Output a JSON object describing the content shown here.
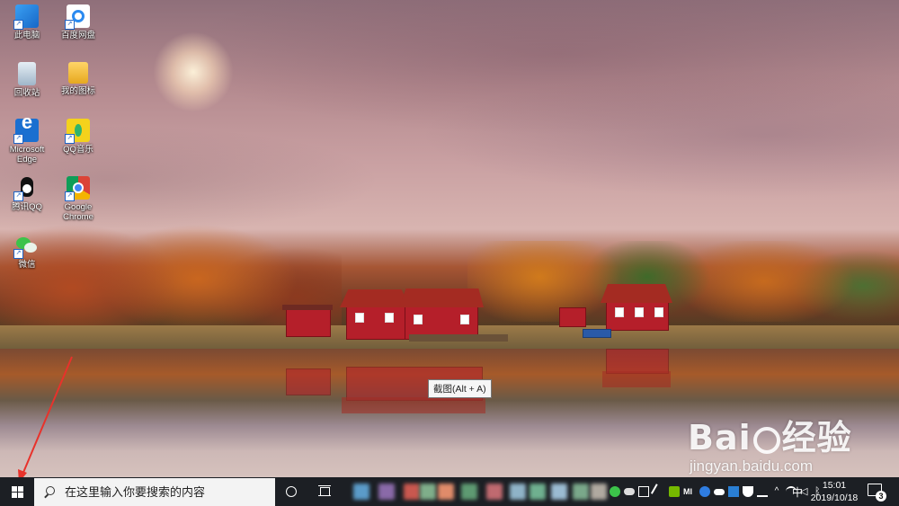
{
  "desktop": {
    "icons": [
      {
        "label": "此电脑",
        "icon": "this-pc-icon"
      },
      {
        "label": "百度网盘",
        "icon": "baidu-netdisk-icon"
      },
      {
        "label": "回收站",
        "icon": "recycle-bin-icon"
      },
      {
        "label": "我的图标",
        "icon": "folder-icon"
      },
      {
        "label": "Microsoft Edge",
        "icon": "edge-icon"
      },
      {
        "label": "QQ音乐",
        "icon": "qq-music-icon"
      },
      {
        "label": "腾讯QQ",
        "icon": "qq-penguin-icon"
      },
      {
        "label": "Google Chrome",
        "icon": "chrome-icon"
      },
      {
        "label": "微信",
        "icon": "wechat-icon"
      }
    ]
  },
  "tooltip": {
    "text": "截图(Alt + A)"
  },
  "watermark": {
    "logo_left": "Bai",
    "logo_right": "经验",
    "url": "jingyan.baidu.com"
  },
  "annotation": {
    "color": "#e8322b",
    "points_to": "start-button"
  },
  "taskbar": {
    "start": {
      "icon": "windows-logo-icon"
    },
    "search": {
      "placeholder": "在这里输入你要搜索的内容",
      "icon": "search-icon"
    },
    "cortana_icon": "cortana-circle-icon",
    "task_view_icon": "task-view-icon",
    "pinned_apps": [
      {
        "color": "#5b9bc9"
      },
      {
        "color": "#8a6aa8"
      },
      {
        "color": "#c9584f"
      },
      {
        "color": "#7fae8a"
      },
      {
        "color": "#e08b6a"
      },
      {
        "color": "#5e9a72"
      },
      {
        "color": "#c06a70"
      },
      {
        "color": "#8fb3c7"
      },
      {
        "color": "#6fb08f"
      },
      {
        "color": "#9bbbd2"
      },
      {
        "color": "#7aa88a"
      },
      {
        "color": "#b0a9a0"
      }
    ],
    "tray": {
      "icons": [
        "wechat-tray-icon",
        "cloud-tray-icon",
        "input-tray-icon",
        "pen-tray-icon",
        "nvidia-tray-icon",
        "mi-tray-icon",
        "baidu-tray-icon",
        "onedrive-tray-icon",
        "app-tray-icon",
        "security-tray-icon",
        "upload-tray-icon",
        "chevron-up-icon",
        "network-icon",
        "volume-icon",
        "bluetooth-icon"
      ],
      "ime": "中",
      "time": "15:01",
      "date": "2019/10/18",
      "notification_count": "3"
    }
  }
}
